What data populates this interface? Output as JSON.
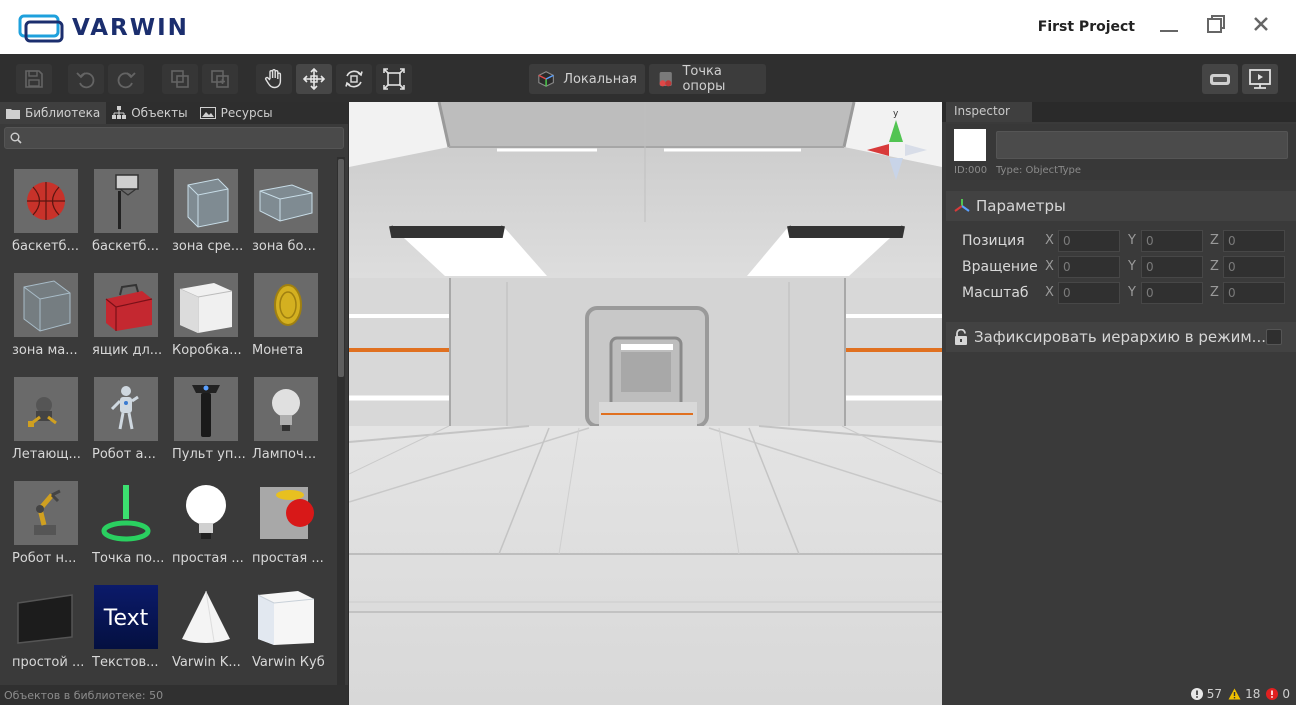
{
  "app": {
    "logo_text": "VARWIN",
    "project_name": "First Project",
    "window_controls": {
      "minimize": "—",
      "maximize": "❐",
      "close": "✕"
    }
  },
  "toolbar": {
    "buttons": [
      "save-icon",
      "undo-icon",
      "redo-icon",
      "duplicate-icon",
      "group-icon",
      "hand-icon",
      "move-icon",
      "rotate-icon",
      "scale-icon"
    ],
    "local_label": "Локальная",
    "pivot_label": "Точка опоры",
    "right_buttons": [
      "vr-preview-icon",
      "desktop-preview-icon"
    ]
  },
  "library": {
    "tabs": [
      {
        "label": "Библиотека",
        "icon": "folder-icon"
      },
      {
        "label": "Объекты",
        "icon": "hierarchy-icon"
      },
      {
        "label": "Ресурсы",
        "icon": "image-icon"
      }
    ],
    "search_placeholder": "",
    "items": [
      {
        "label": "баскетб..."
      },
      {
        "label": "баскетб..."
      },
      {
        "label": "зона сре..."
      },
      {
        "label": "зона бо..."
      },
      {
        "label": "зона ма..."
      },
      {
        "label": "ящик дл..."
      },
      {
        "label": "Коробка..."
      },
      {
        "label": "Монета"
      },
      {
        "label": "Летающ..."
      },
      {
        "label": "Робот а..."
      },
      {
        "label": "Пульт уп..."
      },
      {
        "label": "Лампоч..."
      },
      {
        "label": "Робот н..."
      },
      {
        "label": "Точка по..."
      },
      {
        "label": "простая ..."
      },
      {
        "label": "простая ..."
      },
      {
        "label": "простой ..."
      },
      {
        "label": "Текстов..."
      },
      {
        "label": "Varwin K..."
      },
      {
        "label": "Varwin Куб"
      }
    ],
    "text_thumb_word": "Text",
    "count_label": "Объектов в библиотеке: 50"
  },
  "viewport": {
    "gizmo_axis_label": "y"
  },
  "inspector": {
    "tab_label": "Inspector",
    "id_text": "ID:000",
    "type_text": "Type: ObjectType",
    "name_value": "",
    "params_title": "Параметры",
    "rows": [
      {
        "label": "Позиция",
        "x": "0",
        "y": "0",
        "z": "0"
      },
      {
        "label": "Вращение",
        "x": "0",
        "y": "0",
        "z": "0"
      },
      {
        "label": "Масштаб",
        "x": "0",
        "y": "0",
        "z": "0"
      }
    ],
    "axis_x": "X",
    "axis_y": "Y",
    "axis_z": "Z",
    "lock_label": "Зафиксировать иерархию в режим...",
    "status": {
      "info": "57",
      "warnings": "18",
      "errors": "0"
    }
  },
  "colors": {
    "brand": "#1b2e6e",
    "logo_cyan": "#1ea0dc",
    "error": "#e02020",
    "warning": "#f0c000"
  }
}
